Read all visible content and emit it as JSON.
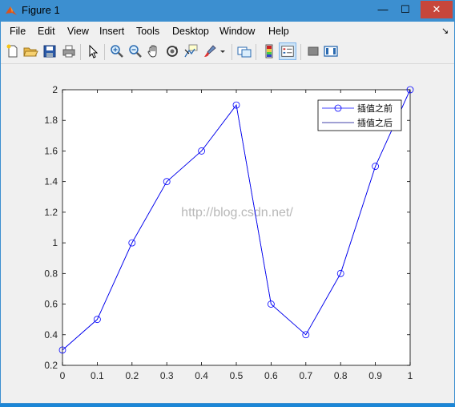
{
  "window": {
    "title": "Figure 1",
    "minimize": "—",
    "maximize": "☐",
    "close": "✕"
  },
  "menu": {
    "items": [
      "File",
      "Edit",
      "View",
      "Insert",
      "Tools",
      "Desktop",
      "Window",
      "Help"
    ],
    "overflow_arrow": "↘"
  },
  "toolbar": {
    "buttons": [
      {
        "name": "new-figure-icon"
      },
      {
        "name": "open-file-icon"
      },
      {
        "name": "save-icon"
      },
      {
        "name": "print-icon"
      },
      {
        "name": "edit-plot-arrow-icon"
      },
      {
        "name": "zoom-in-icon"
      },
      {
        "name": "zoom-out-icon"
      },
      {
        "name": "pan-hand-icon"
      },
      {
        "name": "rotate-3d-icon"
      },
      {
        "name": "data-cursor-icon"
      },
      {
        "name": "brush-icon"
      },
      {
        "name": "brush-dropdown-icon"
      },
      {
        "name": "link-plot-icon"
      },
      {
        "name": "insert-colorbar-icon"
      },
      {
        "name": "insert-legend-icon"
      },
      {
        "name": "hide-plot-tools-icon"
      },
      {
        "name": "show-plot-tools-icon"
      }
    ],
    "pressed": "insert-legend-icon"
  },
  "watermark": "http://blog.csdn.net/",
  "chart_data": {
    "type": "line",
    "x": [
      0,
      0.1,
      0.2,
      0.3,
      0.4,
      0.5,
      0.6,
      0.7,
      0.8,
      0.9,
      1.0
    ],
    "series": [
      {
        "name": "插值之前",
        "values": [
          0.3,
          0.5,
          1.0,
          1.4,
          1.6,
          1.9,
          0.6,
          0.4,
          0.8,
          1.5,
          2.0
        ],
        "marker": "circle",
        "color": "#0000ff"
      },
      {
        "name": "插值之后",
        "values": [
          0.3,
          0.5,
          1.0,
          1.4,
          1.6,
          1.9,
          0.6,
          0.4,
          0.8,
          1.5,
          2.0
        ],
        "marker": "none",
        "color": "#00008b"
      }
    ],
    "xlim": [
      0,
      1
    ],
    "ylim": [
      0.2,
      2
    ],
    "xticks": [
      "0",
      "0.1",
      "0.2",
      "0.3",
      "0.4",
      "0.5",
      "0.6",
      "0.7",
      "0.8",
      "0.9",
      "1"
    ],
    "yticks": [
      "0.2",
      "0.4",
      "0.6",
      "0.8",
      "1",
      "1.2",
      "1.4",
      "1.6",
      "1.8",
      "2"
    ],
    "title": "",
    "xlabel": "",
    "ylabel": "",
    "grid": false,
    "legend_position": "top-right"
  }
}
